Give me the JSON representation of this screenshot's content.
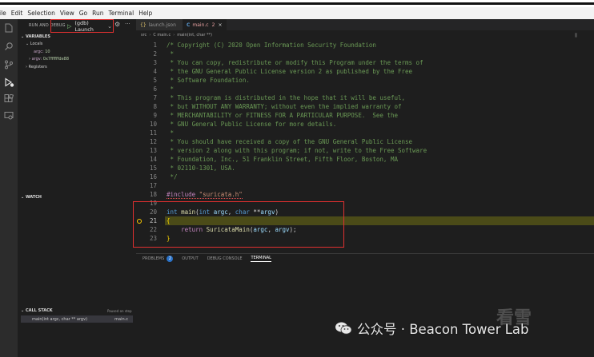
{
  "menu": [
    "ile",
    "Edit",
    "Selection",
    "View",
    "Go",
    "Run",
    "Terminal",
    "Help"
  ],
  "debug": {
    "title": "RUN AND DEBUG",
    "config": "(gdb) Launch"
  },
  "variables": {
    "header": "VARIABLES",
    "locals_label": "Locals",
    "items": [
      {
        "name": "argc:",
        "value": "10"
      },
      {
        "name": "argv:",
        "value": "0x7ffffffde88"
      }
    ],
    "registers_label": "Registers"
  },
  "watch": {
    "header": "WATCH"
  },
  "callstack": {
    "header": "CALL STACK",
    "status": "Paused on step",
    "frame": "main(int argc, char ** argv)",
    "file": "main.c"
  },
  "tabs": [
    {
      "icon": "{}",
      "label": "launch.json"
    },
    {
      "icon": "C",
      "label": "main.c",
      "dirty": "2",
      "close": "×"
    }
  ],
  "breadcrumbs": [
    "src",
    "C main.c",
    "main(int, char **)"
  ],
  "code": [
    {
      "n": "1",
      "t": "/* Copyright (C) 2020 Open Information Security Foundation"
    },
    {
      "n": "2",
      "t": " *"
    },
    {
      "n": "3",
      "t": " * You can copy, redistribute or modify this Program under the terms of"
    },
    {
      "n": "4",
      "t": " * the GNU General Public License version 2 as published by the Free"
    },
    {
      "n": "5",
      "t": " * Software Foundation."
    },
    {
      "n": "6",
      "t": " *"
    },
    {
      "n": "7",
      "t": " * This program is distributed in the hope that it will be useful,"
    },
    {
      "n": "8",
      "t": " * but WITHOUT ANY WARRANTY; without even the implied warranty of"
    },
    {
      "n": "9",
      "t": " * MERCHANTABILITY or FITNESS FOR A PARTICULAR PURPOSE.  See the"
    },
    {
      "n": "10",
      "t": " * GNU General Public License for more details."
    },
    {
      "n": "11",
      "t": " *"
    },
    {
      "n": "12",
      "t": " * You should have received a copy of the GNU General Public License"
    },
    {
      "n": "13",
      "t": " * version 2 along with this program; if not, write to the Free Software"
    },
    {
      "n": "14",
      "t": " * Foundation, Inc., 51 Franklin Street, Fifth Floor, Boston, MA"
    },
    {
      "n": "15",
      "t": " * 02110-1301, USA."
    },
    {
      "n": "16",
      "t": " */"
    },
    {
      "n": "17",
      "t": ""
    },
    {
      "n": "18",
      "t": "#include \"suricata.h\""
    },
    {
      "n": "19",
      "t": ""
    },
    {
      "n": "20",
      "t": "int main(int argc, char **argv)"
    },
    {
      "n": "21",
      "t": "{"
    },
    {
      "n": "22",
      "t": "    return SuricataMain(argc, argv);"
    },
    {
      "n": "23",
      "t": "}"
    }
  ],
  "tokens": {
    "include_kw": "#include",
    "include_str": "\"suricata.h\"",
    "int1": "int",
    "main": "main",
    "paren_open": "(",
    "int2": "int",
    "argc": "argc",
    "comma": ", ",
    "char": "char",
    "stars": "**",
    "argv": "argv",
    "paren_close": ")",
    "return": "return",
    "suricata_main": "SuricataMain",
    "args_open": "(",
    "argc2": "argc",
    "comma2": ", ",
    "argv2": "argv",
    "args_close": ");"
  },
  "panel": {
    "tabs": [
      "PROBLEMS",
      "OUTPUT",
      "DEBUG CONSOLE",
      "TERMINAL"
    ],
    "problems_count": "2",
    "active": "TERMINAL"
  },
  "watermark": {
    "text": "公众号 · Beacon Tower Lab",
    "corner": "看雪"
  },
  "colors": {
    "comment": "#6a9955",
    "keyword": "#569cd6",
    "function": "#dcdcaa",
    "variable": "#9cdcfe",
    "string": "#ce9178",
    "highlight_box": "#e03030",
    "current_line": "#4b4b18"
  }
}
